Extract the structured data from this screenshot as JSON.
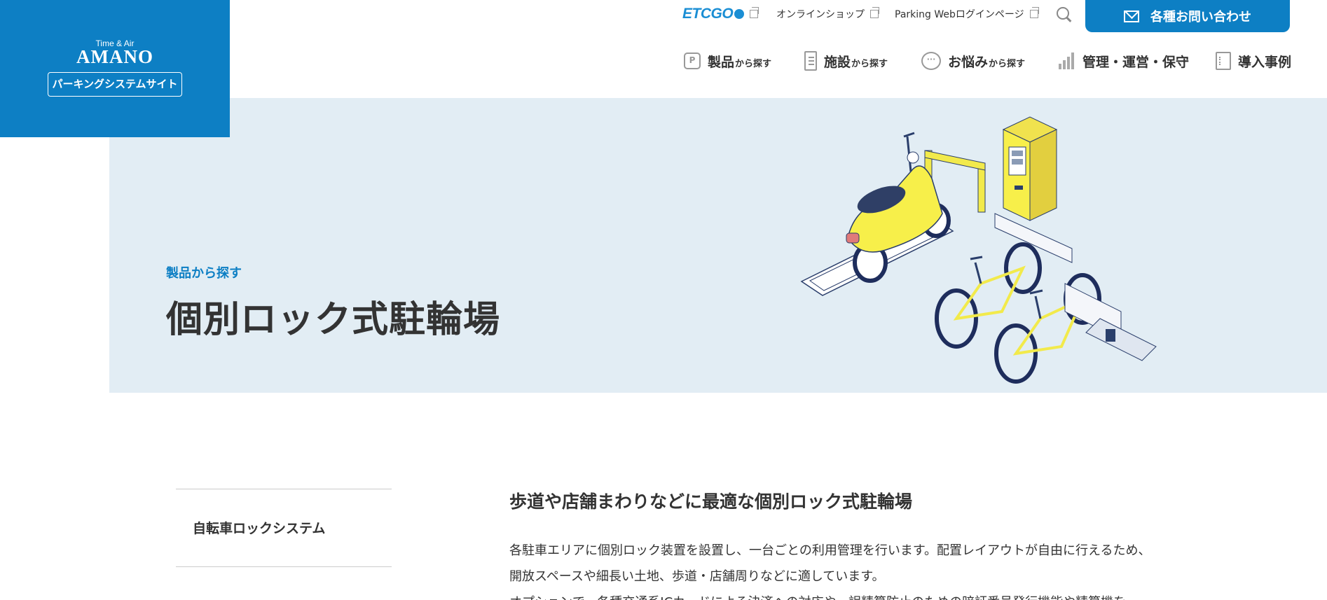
{
  "logo": {
    "tagline": "Time & Air",
    "name": "AMANO",
    "site_label": "パーキングシステムサイト",
    "color": "#0d7fc4"
  },
  "utility_links": {
    "etcgo": "ETCGO",
    "online_shop": "オンラインショップ",
    "parking_web_login": "Parking Webログインページ",
    "search_icon": "search-icon",
    "external_icon": "external-link-icon"
  },
  "contact_button": {
    "label": "各種お問い合わせ",
    "icon": "mail-icon"
  },
  "main_nav": [
    {
      "icon": "p-icon",
      "icon_text": "P",
      "main": "製品",
      "sub": "から探す"
    },
    {
      "icon": "building-icon",
      "main": "施設",
      "sub": "から探す"
    },
    {
      "icon": "speech-bubble-icon",
      "icon_text": "···",
      "main": "お悩み",
      "sub": "から探す"
    },
    {
      "icon": "bar-chart-icon",
      "main": "管理・運営・保守",
      "sub": ""
    },
    {
      "icon": "document-icon",
      "main": "導入事例",
      "sub": ""
    }
  ],
  "hero": {
    "eyebrow": "製品から探す",
    "title": "個別ロック式駐輪場",
    "background": "#e2edf4",
    "illustration": "bicycle-parking-illustration"
  },
  "sidebar": {
    "items": [
      {
        "label": "自転車ロックシステム"
      }
    ]
  },
  "content": {
    "heading": "歩道や店舗まわりなどに最適な個別ロック式駐輪場",
    "paragraphs": [
      "各駐車エリアに個別ロック装置を設置し、一台ごとの利用管理を行います。配置レイアウトが自由に行えるため、",
      "開放スペースや細長い土地、歩道・店舗周りなどに適しています。",
      "オプションで、各種交通系ICカードによる決済への対応や、誤精算防止のための暗証番号発行機能や精算機を"
    ]
  }
}
